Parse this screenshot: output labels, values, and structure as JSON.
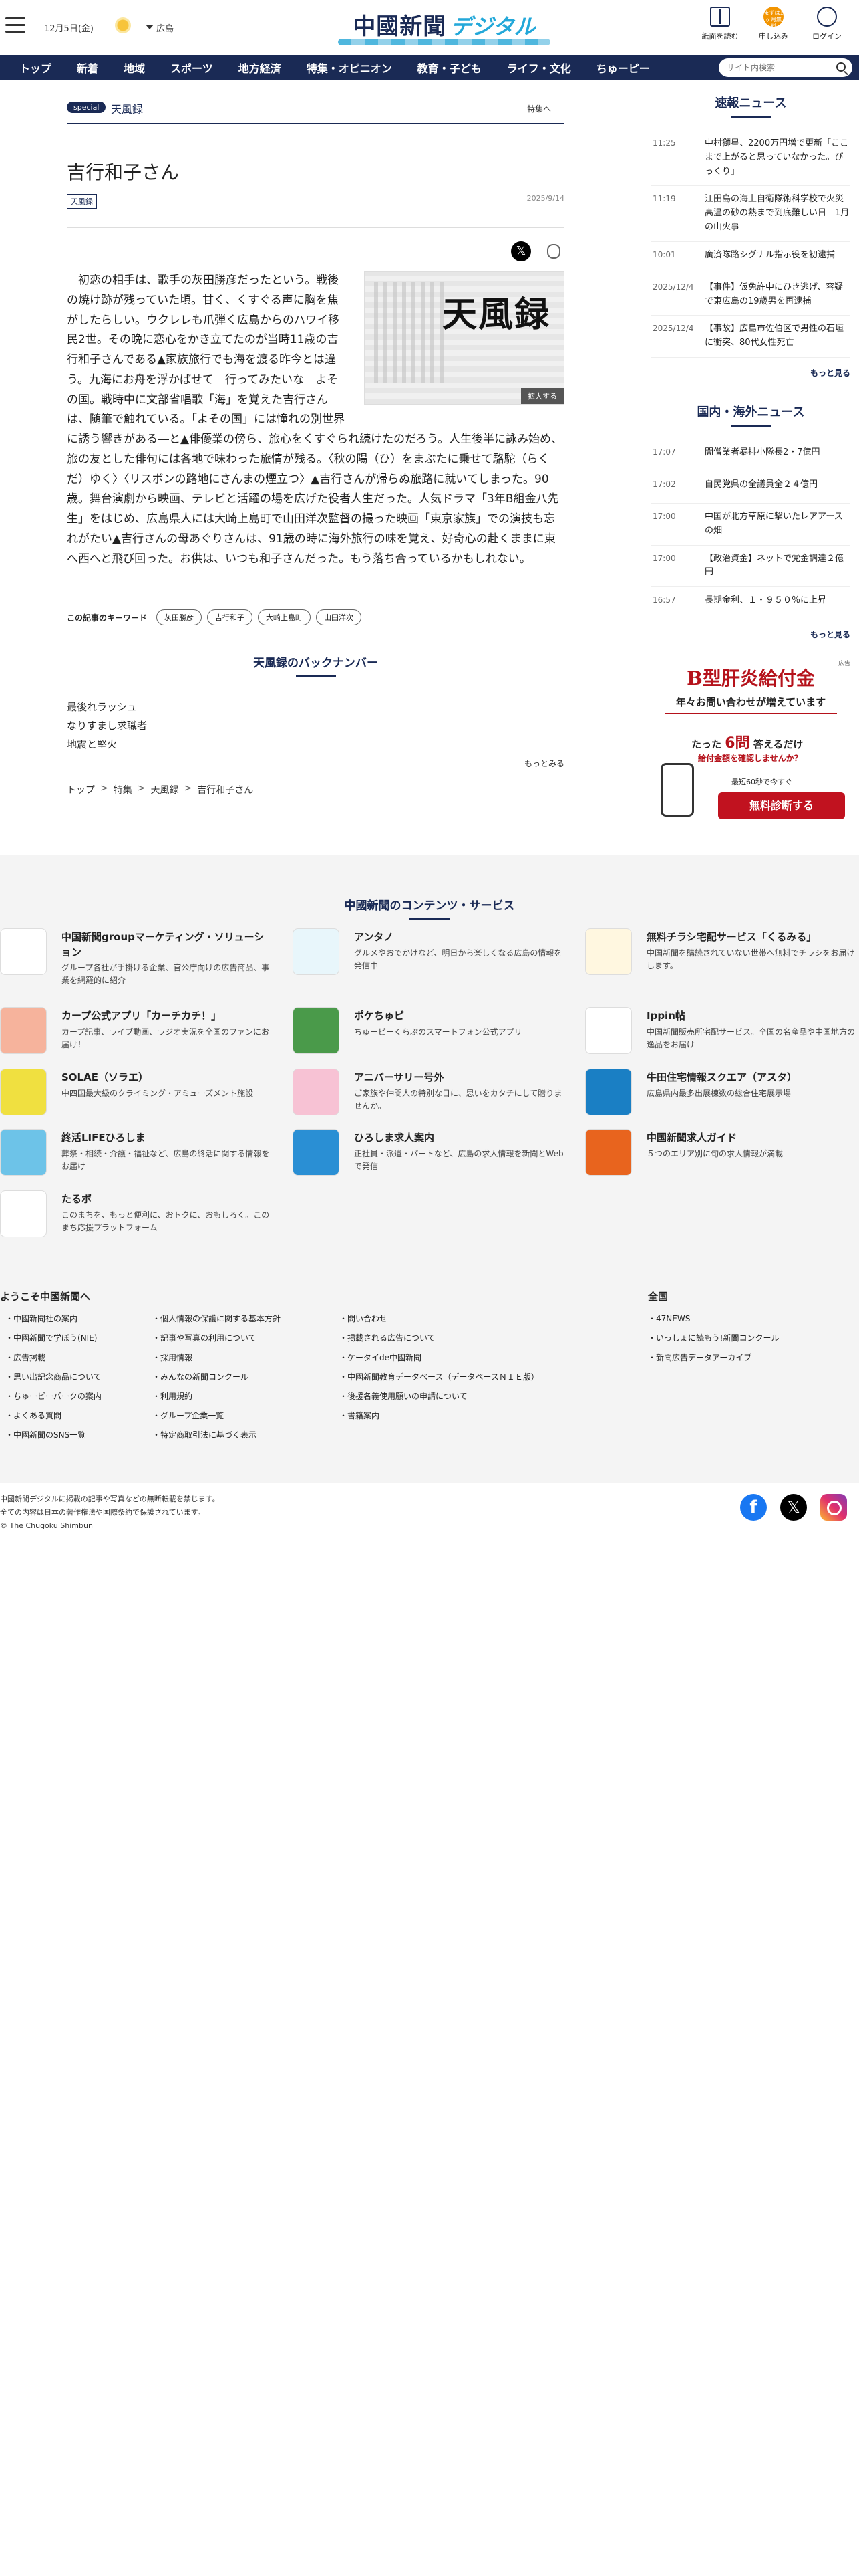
{
  "header": {
    "date": "12月5日(金)",
    "weather_icon": "sun-icon",
    "region": "広島",
    "logo_main": "中國新聞",
    "logo_sub": "デジタル",
    "buttons": {
      "paper": "紙面を読む",
      "apply_badge": "まずは1ヶ月無料",
      "apply": "申し込み",
      "login": "ログイン"
    }
  },
  "nav": {
    "items": [
      "トップ",
      "新着",
      "地域",
      "スポーツ",
      "地方経済",
      "特集・オピニオン",
      "教育・子ども",
      "ライフ・文化",
      "ちゅーピー"
    ],
    "search_placeholder": "サイト内検索"
  },
  "article": {
    "section_pill": "special",
    "section_name": "天風録",
    "feature_link": "特集へ",
    "title": "吉行和子さん",
    "tag": "天風録",
    "date": "2025/9/14",
    "figure_title": "天風録",
    "zoom_label": "拡大する",
    "body": "初恋の相手は、歌手の灰田勝彦だったという。戦後の焼け跡が残っていた頃。甘く、くすぐる声に胸を焦がしたらしい。ウクレレも爪弾く広島からのハワイ移民2世。その晩に恋心をかき立てたのが当時11歳の吉行和子さんである▲家族旅行でも海を渡る昨今とは違う。九海にお舟を浮かばせて　行ってみたいな　よその国。戦時中に文部省唱歌「海」を覚えた吉行さんは、随筆で触れている。「よその国」には憧れの別世界に誘う響きがある―と▲俳優業の傍ら、旅心をくすぐられ続けたのだろう。人生後半に詠み始め、旅の友とした俳句には各地で味わった旅情が残る。〈秋の陽（ひ）をまぶたに乗せて駱駝（らくだ）ゆく〉〈リスボンの路地にさんまの煙立つ〉▲吉行さんが帰らぬ旅路に就いてしまった。90歳。舞台演劇から映画、テレビと活躍の場を広げた役者人生だった。人気ドラマ「3年B組金八先生」をはじめ、広島県人には大崎上島町で山田洋次監督の撮った映画「東京家族」での演技も忘れがたい▲吉行さんの母あぐりさんは、91歳の時に海外旅行の味を覚え、好奇心の赴くままに東へ西へと飛び回った。お供は、いつも和子さんだった。もう落ち合っているかもしれない。",
    "keywords_label": "この記事のキーワード",
    "keywords": [
      "灰田勝彦",
      "吉行和子",
      "大崎上島町",
      "山田洋次"
    ],
    "backnumber_title": "天風録のバックナンバー",
    "backnumbers": [
      "最後れラッシュ",
      "なりすまし求職者",
      "地震と堅火"
    ],
    "more_label": "もっとみる",
    "breadcrumb": [
      "トップ",
      "特集",
      "天風録",
      "吉行和子さん"
    ]
  },
  "sidebar": {
    "breaking_title": "速報ニュース",
    "breaking": [
      {
        "time": "11:25",
        "text": "中村獅星、2200万円増で更新「ここまで上がると思っていなかった。びっくり」"
      },
      {
        "time": "11:19",
        "text": "江田島の海上自衛隊術科学校で火災　高温の砂の熱まで到底難しい日　1月の山火事"
      },
      {
        "time": "10:01",
        "text": "廣済隊路シグナル指示役を初逮捕"
      },
      {
        "time": "2025/12/4",
        "text": "【事件】仮免許中にひき逃げ、容疑で東広島の19歳男を再逮捕"
      },
      {
        "time": "2025/12/4",
        "text": "【事故】広島市佐伯区で男性の石垣に衝突、80代女性死亡"
      }
    ],
    "national_title": "国内・海外ニュース",
    "national": [
      {
        "time": "17:07",
        "text": "闇僧業者暴排小隊長2・7億円"
      },
      {
        "time": "17:02",
        "text": "自民党県の全議員全２４億円"
      },
      {
        "time": "17:00",
        "text": "中国が北方草原に撃いたレアアースの畑"
      },
      {
        "time": "17:00",
        "text": "【政治資金】ネットで党金調達２億円"
      },
      {
        "time": "16:57",
        "text": "長期金利、１・９５０％に上昇"
      }
    ],
    "more_label": "もっと見る",
    "ad": {
      "tag": "広告",
      "title": "B型肝炎給付金",
      "subtitle": "年々お問い合わせが増えています",
      "q1_pre": "たった",
      "q1_num": "6問",
      "q1_post": "答えるだけ",
      "q2": "給付金額を確認しませんか？",
      "q3": "最短60秒で今すぐ",
      "button": "無料診断する"
    }
  },
  "services": {
    "title": "中國新聞のコンテンツ・サービス",
    "items": [
      {
        "name": "中国新聞groupマーケティング・ソリューション",
        "desc": "グループ各社が手掛ける企業、官公庁向けの広告商品、事業を網羅的に紹介",
        "icon": "chugoku-group-icon",
        "color": "#ffffff"
      },
      {
        "name": "アンタノ",
        "desc": "グルメやおでかけなど、明日から楽しくなる広島の情報を発信中",
        "icon": "antano-icon",
        "color": "#e8f6fb"
      },
      {
        "name": "無料チラシ宅配サービス「くるみる」",
        "desc": "中国新聞を購読されていない世帯へ無料でチラシをお届けします。",
        "icon": "kurumiru-icon",
        "color": "#fff7e0"
      },
      {
        "name": "カープ公式アプリ「カーチカチ！」",
        "desc": "カープ記事、ライブ動画、ラジオ実況を全国のファンにお届け！",
        "icon": "carp-app-icon",
        "color": "#f6b39c"
      },
      {
        "name": "ポケちゅピ",
        "desc": "ちゅーピーくらぶのスマートフォン公式アプリ",
        "icon": "pokechupi-icon",
        "color": "#4a9a4a"
      },
      {
        "name": "Ippin帖",
        "desc": "中国新聞販売所宅配サービス。全国の名産品や中国地方の逸品をお届け",
        "icon": "ippin-icon",
        "color": "#ffffff"
      },
      {
        "name": "SOLAE（ソラエ）",
        "desc": "中四国最大級のクライミング・アミューズメント施設",
        "icon": "solae-icon",
        "color": "#f0e040"
      },
      {
        "name": "アニバーサリー号外",
        "desc": "ご家族や仲間人の特別な日に、思いをカタチにして贈りませんか。",
        "icon": "anniversary-icon",
        "color": "#f7c2d4"
      },
      {
        "name": "牛田住宅情報スクエア（アスタ）",
        "desc": "広島県内最多出展棟数の総合住宅展示場",
        "icon": "asta-icon",
        "color": "#1a7fc4"
      },
      {
        "name": "終活LIFEひろしま",
        "desc": "葬祭・相続・介護・福祉など、広島の終活に関する情報をお届け",
        "icon": "shukatsu-icon",
        "color": "#6dc3e8"
      },
      {
        "name": "ひろしま求人案内",
        "desc": "正社員・派遣・パートなど、広島の求人情報を新聞とWebで発信",
        "icon": "kyujin-icon",
        "color": "#2a8fd4"
      },
      {
        "name": "中国新聞求人ガイド",
        "desc": "５つのエリア別に旬の求人情報が満載",
        "icon": "kyujin-guide-icon",
        "color": "#e8641e"
      },
      {
        "name": "たるポ",
        "desc": "このまちを、もっと便利に、おトクに、おもしろく。このまち応援プラットフォーム",
        "icon": "tarupo-icon",
        "color": "#ffffff"
      }
    ]
  },
  "links": {
    "welcome_title": "ようこそ中國新聞へ",
    "col1": [
      "中國新聞社の案内",
      "中國新聞で学ぼう(NIE)",
      "広告掲載",
      "思い出記念商品について",
      "ちゅーピーパークの案内",
      "よくある質問",
      "中國新聞のSNS一覧"
    ],
    "col2": [
      "個人情報の保護に関する基本方針",
      "記事や写真の利用について",
      "採用情報",
      "みんなの新聞コンクール",
      "利用規約",
      "グループ企業一覧",
      "特定商取引法に基づく表示"
    ],
    "col3": [
      "問い合わせ",
      "掲載される広告について",
      "ケータイde中國新聞",
      "中國新聞教育データベース（データベースＮＩＥ版）",
      "後援名義使用願いの申請について",
      "書籍案内"
    ],
    "national_title": "全国",
    "col4": [
      "47NEWS",
      "いっしょに読もう!新聞コンクール",
      "新聞広告データアーカイブ"
    ]
  },
  "footer": {
    "lines": [
      "中國新聞デジタルに掲載の記事や写真などの無断転載を禁じます。",
      "全ての内容は日本の著作権法や国際条約で保護されています。",
      "© The Chugoku Shimbun"
    ],
    "social": [
      "facebook-icon",
      "x-icon",
      "instagram-icon"
    ]
  }
}
